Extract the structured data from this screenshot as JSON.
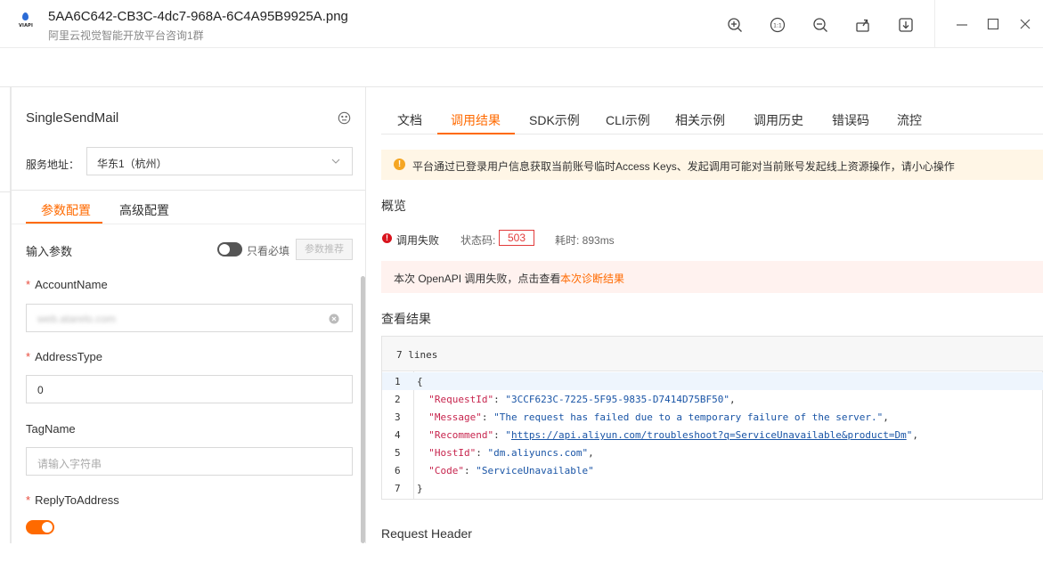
{
  "window": {
    "file_title": "5AA6C642-CB3C-4dc7-968A-6C4A95B9925A.png",
    "subtitle": "阿里云视觉智能开放平台咨询1群",
    "logo_text": "VIAPI",
    "toolbar_icons": [
      "zoom-in-icon",
      "actual-size-icon",
      "zoom-out-icon",
      "share-icon",
      "download-icon"
    ],
    "controls": [
      "minimize-icon",
      "maximize-icon",
      "close-icon"
    ]
  },
  "left_panel": {
    "api_name": "SingleSendMail",
    "service_label": "服务地址：",
    "service_value": "华东1（杭州）",
    "tabs": [
      {
        "label": "参数配置",
        "active": true
      },
      {
        "label": "高级配置",
        "active": false
      }
    ],
    "section_title": "输入参数",
    "only_required_label": "只看必填",
    "recommend_button": "参数推荐",
    "fields": [
      {
        "name": "AccountName",
        "required": true,
        "value": "web.atarelo.com",
        "placeholder": ""
      },
      {
        "name": "AddressType",
        "required": true,
        "value": "0",
        "placeholder": ""
      },
      {
        "name": "TagName",
        "required": false,
        "value": "",
        "placeholder": "请输入字符串"
      },
      {
        "name": "ReplyToAddress",
        "required": true,
        "value": "",
        "placeholder": ""
      }
    ],
    "reply_toggle_on": true
  },
  "right_panel": {
    "tabs": [
      "文档",
      "调用结果",
      "SDK示例",
      "CLI示例",
      "相关示例",
      "调用历史",
      "错误码",
      "流控"
    ],
    "active_tab": "调用结果",
    "warning": "平台通过已登录用户信息获取当前账号临时Access Keys、发起调用可能对当前账号发起线上资源操作，请小心操作",
    "overview_title": "概览",
    "call_status": "调用失败",
    "status_code_label": "状态码:",
    "status_code": "503",
    "time_label": "耗时: 893ms",
    "fail_text": "本次 OpenAPI 调用失败，点击查看",
    "fail_link": "本次诊断结果",
    "result_title": "查看结果",
    "code_header": "7 lines",
    "code_lines": [
      {
        "n": "1",
        "text": "{"
      },
      {
        "n": "2",
        "key": "\"RequestId\"",
        "val": "\"3CCF623C-7225-5F95-9835-D7414D75BF50\"",
        "tail": ","
      },
      {
        "n": "3",
        "key": "\"Message\"",
        "val": "\"The request has failed due to a temporary failure of the server.\"",
        "tail": ","
      },
      {
        "n": "4",
        "key": "\"Recommend\"",
        "val_pre": "\"",
        "url": "https://api.aliyun.com/troubleshoot?q=ServiceUnavailable&product=Dm",
        "val_post": "\"",
        "tail": ","
      },
      {
        "n": "5",
        "key": "\"HostId\"",
        "val": "\"dm.aliyuncs.com\"",
        "tail": ","
      },
      {
        "n": "6",
        "key": "\"Code\"",
        "val": "\"ServiceUnavailable\"",
        "tail": ""
      },
      {
        "n": "7",
        "text": "}"
      }
    ],
    "request_header": "Request Header"
  },
  "colors": {
    "accent": "#ff6a00",
    "error": "#d9141d",
    "warning_bg": "#fff6e6"
  }
}
